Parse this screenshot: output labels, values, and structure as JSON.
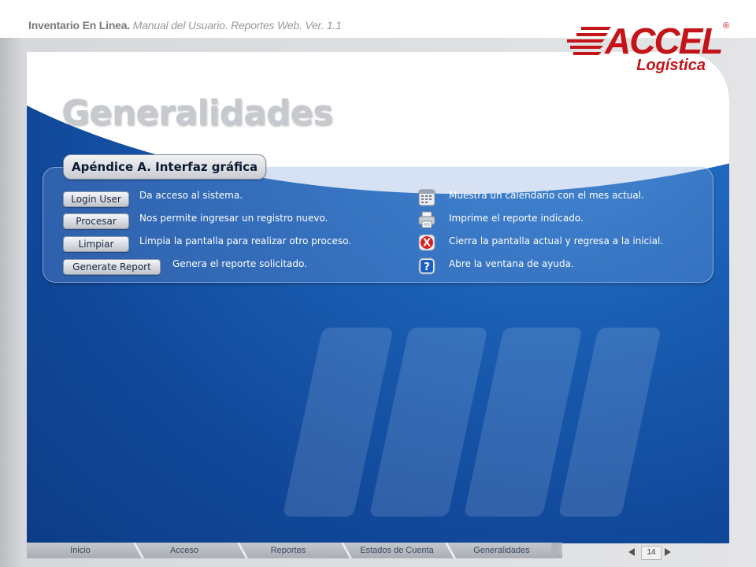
{
  "header": {
    "title_bold": "Inventario En Linea.",
    "title_rest": "Manual del Usuario. Reportes Web. Ver. 1.1"
  },
  "logo": {
    "brand": "ACCEL",
    "registered": "®",
    "subtitle": "Logística"
  },
  "page": {
    "title": "Generalidades"
  },
  "section": {
    "heading": "Apéndice A. Interfaz gráfica"
  },
  "buttons": [
    {
      "label": "Login User",
      "description": "Da acceso al sistema."
    },
    {
      "label": "Procesar",
      "description": "Nos permite ingresar un registro nuevo."
    },
    {
      "label": "Limpiar",
      "description": "Limpia la pantalla para realizar otro proceso."
    },
    {
      "label": "Generate Report",
      "description": "Genera el reporte solicitado."
    }
  ],
  "icons": [
    {
      "icon": "calendar-icon",
      "description": "Muestra un calendario con el mes actual."
    },
    {
      "icon": "printer-icon",
      "description": "Imprime el reporte indicado."
    },
    {
      "icon": "close-icon",
      "glyph": "X",
      "description": "Cierra la pantalla actual y regresa a la inicial."
    },
    {
      "icon": "help-icon",
      "glyph": "?",
      "description": "Abre la ventana de ayuda."
    }
  ],
  "nav": {
    "tabs": [
      "Inicio",
      "Acceso",
      "Reportes",
      "Estados de Cuenta",
      "Generalidades"
    ],
    "page_number": "14"
  },
  "colors": {
    "accent_red": "#c41419",
    "panel_blue": "#1a5fb4",
    "close_red": "#d62020",
    "help_blue": "#1d5fc0"
  }
}
